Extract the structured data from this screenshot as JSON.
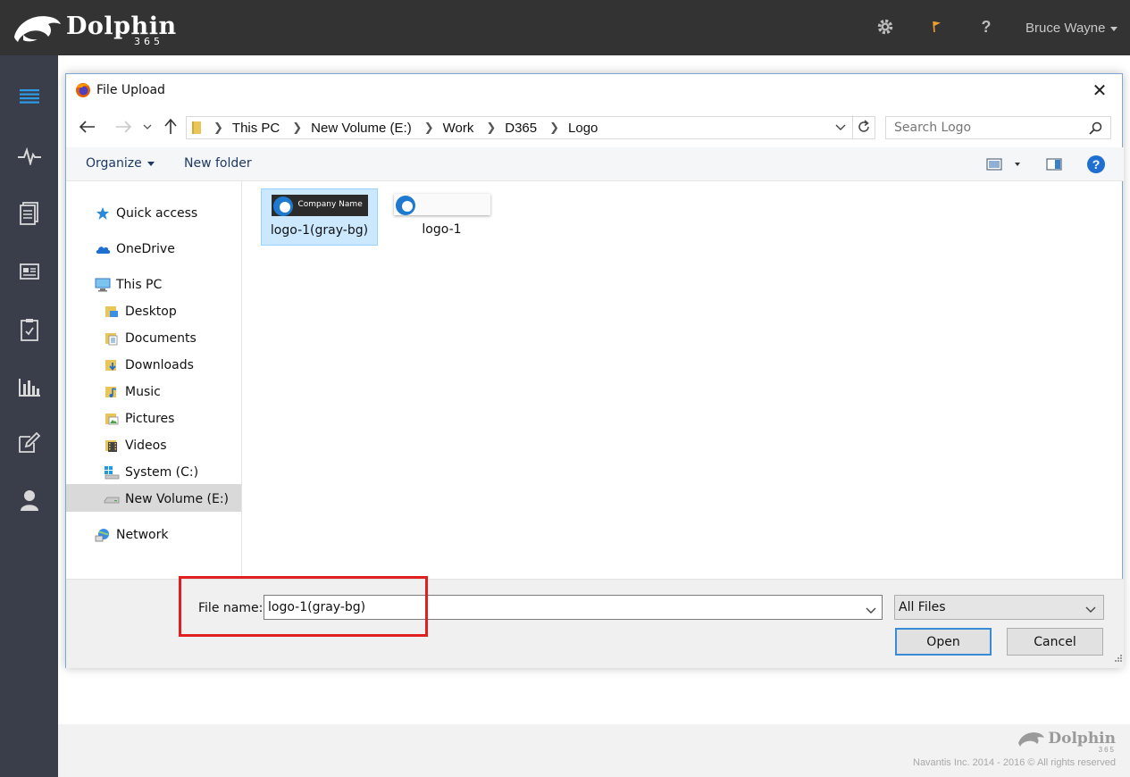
{
  "app": {
    "brand_name": "Dolphin",
    "brand_sub": "365",
    "user_name": "Bruce Wayne"
  },
  "header_icons": [
    "gear-icon",
    "flag-icon",
    "help-icon"
  ],
  "header": {
    "help_glyph": "?"
  },
  "sidenav": {
    "items": [
      "list-icon",
      "pulse-icon",
      "document-icon",
      "id-card-icon",
      "clipboard-icon",
      "bar-chart-icon",
      "edit-icon",
      "user-icon"
    ]
  },
  "dialog": {
    "title": "File Upload",
    "close_glyph": "✕",
    "address": {
      "crumbs": [
        "This PC",
        "New Volume (E:)",
        "Work",
        "D365",
        "Logo"
      ]
    },
    "search": {
      "placeholder": "Search Logo"
    },
    "commands": {
      "organize": "Organize",
      "new_folder": "New folder"
    },
    "tree": [
      {
        "label": "Quick access"
      },
      {
        "label": "OneDrive"
      },
      {
        "label": "This PC"
      },
      {
        "label": "Desktop"
      },
      {
        "label": "Documents"
      },
      {
        "label": "Downloads"
      },
      {
        "label": "Music"
      },
      {
        "label": "Pictures"
      },
      {
        "label": "Videos"
      },
      {
        "label": "System (C:)"
      },
      {
        "label": "New Volume (E:)",
        "selected": true
      },
      {
        "label": "Network"
      }
    ],
    "files": [
      {
        "name": "logo-1(gray-bg)",
        "thumb_text": "Company Name",
        "selected": true
      },
      {
        "name": "logo-1",
        "thumb_text": "",
        "selected": false
      }
    ],
    "file_name_label": "File name:",
    "file_name_value": "logo-1(gray-bg)",
    "file_type": "All Files",
    "open_label": "Open",
    "cancel_label": "Cancel"
  },
  "footer": {
    "brand_name": "Dolphin",
    "brand_sub": "365",
    "copyright": "Navantis Inc. 2014 - 2016 © All rights reserved"
  },
  "colors": {
    "topbar": "#333333",
    "sidenav": "#3a3e4a",
    "accent_blue": "#3b8ad6",
    "highlight_red": "#e02020",
    "flag_orange": "#f0a030"
  }
}
